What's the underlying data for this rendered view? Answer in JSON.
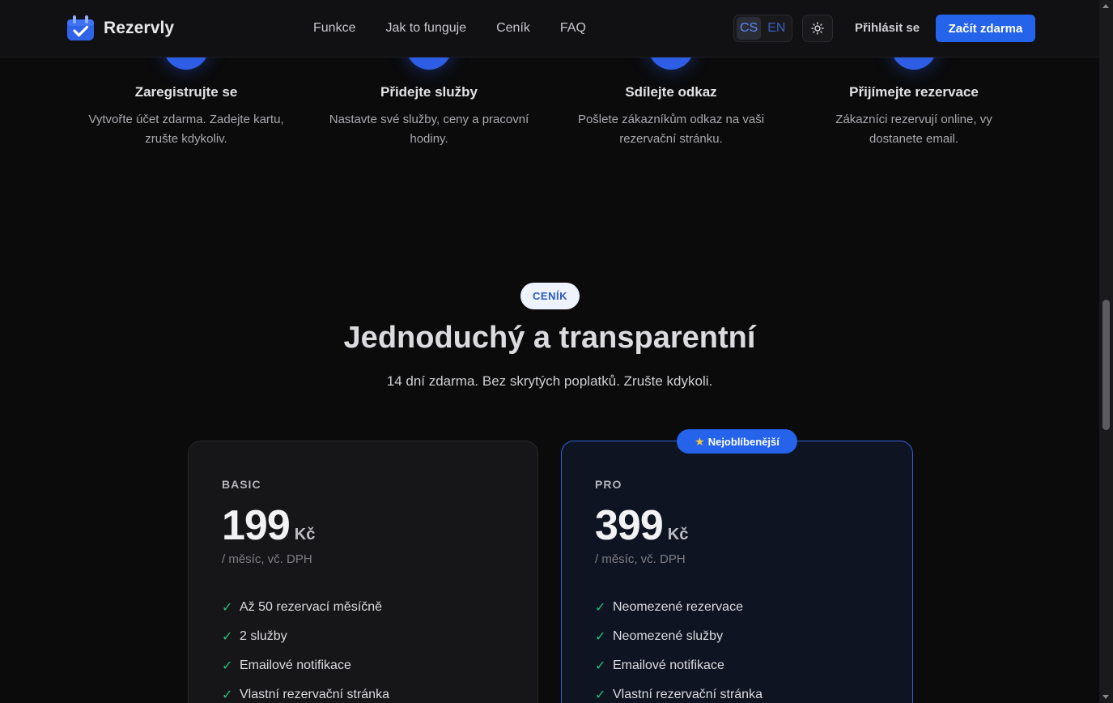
{
  "header": {
    "logo_text": "Rezervly",
    "nav": [
      "Funkce",
      "Jak to funguje",
      "Ceník",
      "FAQ"
    ],
    "lang_cs": "CS",
    "lang_en": "EN",
    "login": "Přihlásit se",
    "cta": "Začít zdarma"
  },
  "steps": [
    {
      "title": "Zaregistrujte se",
      "desc_l1": "Vytvořte účet zdarma. Zadejte kartu,",
      "desc_l2": "zrušte kdykoliv."
    },
    {
      "title": "Přidejte služby",
      "desc_l1": "Nastavte své služby, ceny a pracovní",
      "desc_l2": "hodiny."
    },
    {
      "title": "Sdílejte odkaz",
      "desc_l1": "Pošlete zákazníkům odkaz na vaši",
      "desc_l2": "rezervační stránku."
    },
    {
      "title": "Přijímejte rezervace",
      "desc_l1": "Zákazníci rezervují online, vy",
      "desc_l2": "dostanete email."
    }
  ],
  "pricing": {
    "badge": "CENÍK",
    "title": "Jednoduchý a transparentní",
    "subtitle": "14 dní zdarma. Bez skrytých poplatků. Zrušte kdykoli.",
    "popular_badge": "Nejoblíbenější",
    "plans": [
      {
        "name": "BASIC",
        "price": "199",
        "currency": "Kč",
        "period": "/ měsíc, vč. DPH",
        "features": [
          "Až 50 rezervací měsíčně",
          "2 služby",
          "Emailové notifikace",
          "Vlastní rezervační stránka"
        ]
      },
      {
        "name": "PRO",
        "price": "399",
        "currency": "Kč",
        "period": "/ měsíc, vč. DPH",
        "features": [
          "Neomezené rezervace",
          "Neomezené služby",
          "Emailové notifikace",
          "Vlastní rezervační stránka"
        ]
      }
    ]
  },
  "colors": {
    "accent": "#2563eb",
    "background": "#0b0b0c",
    "check": "#22c07a"
  },
  "icons": [
    "calendar-check-icon",
    "sun-icon",
    "check-icon",
    "star-icon"
  ]
}
